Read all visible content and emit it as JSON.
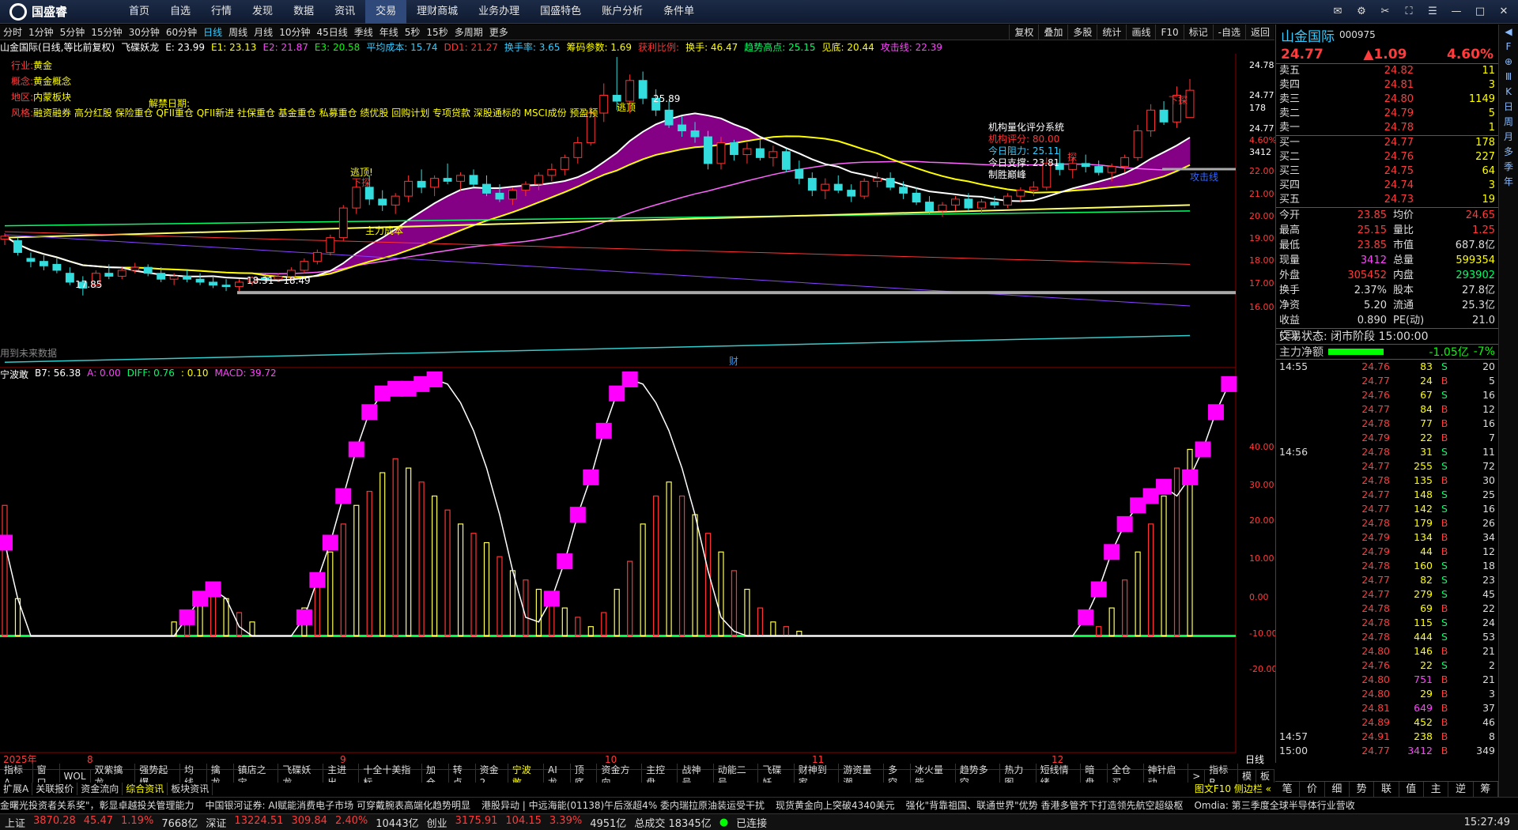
{
  "app": {
    "brand": "国盛睿",
    "menu": [
      "首页",
      "自选",
      "行情",
      "发现",
      "数据",
      "资讯",
      "交易",
      "理财商城",
      "业务办理",
      "国盛特色",
      "账户分析",
      "条件单"
    ],
    "active_menu": "交易"
  },
  "window_controls": [
    "消息",
    "设置",
    "工具",
    "全屏",
    "菜单",
    "最小化",
    "最大化",
    "关闭"
  ],
  "timeframes": [
    "分时",
    "1分钟",
    "5分钟",
    "15分钟",
    "30分钟",
    "60分钟",
    "日线",
    "周线",
    "月线",
    "10分钟",
    "45日线",
    "季线",
    "年线",
    "5秒",
    "15秒",
    "多周期",
    "更多"
  ],
  "active_timeframe": "日线",
  "toolbar_right": [
    "复权",
    "叠加",
    "多股",
    "统计",
    "画线",
    "F10",
    "标记",
    "-自选",
    "返回"
  ],
  "main_header": [
    {
      "t": "山金国际(日线,等比前复权)",
      "c": "#ffffff"
    },
    {
      "t": "飞碟妖龙",
      "c": "#ffffff"
    },
    {
      "t": "E: 23.99",
      "c": "#ffffff"
    },
    {
      "t": "E1: 23.13",
      "c": "#ffff00"
    },
    {
      "t": "E2: 21.87",
      "c": "#ff44ff"
    },
    {
      "t": "E3: 20.58",
      "c": "#00ff00"
    },
    {
      "t": "平均成本: 15.74",
      "c": "#33ccff"
    },
    {
      "t": "DD1: 21.27",
      "c": "#ff3333"
    },
    {
      "t": "换手率: 3.65",
      "c": "#33ccff"
    },
    {
      "t": "筹码参数: 1.69",
      "c": "#ffff00"
    },
    {
      "t": "获利比例:",
      "c": "#ff3333"
    },
    {
      "t": "换手: 46.47",
      "c": "#ffff00"
    },
    {
      "t": "趋势高点: 25.15",
      "c": "#00ff66"
    },
    {
      "t": "见底: 20.44",
      "c": "#ffff00"
    },
    {
      "t": "攻击线: 22.39",
      "c": "#ff44ff"
    }
  ],
  "info_lines": [
    {
      "k": "行业:",
      "v": "黄金"
    },
    {
      "k": "概念:",
      "v": "黄金概念"
    },
    {
      "k": "地区:",
      "v": "内蒙板块"
    },
    {
      "k": "风格:",
      "v": "融资融券 高分红股 保险重仓 QFII重仓 QFII新进 社保重仓 基金重仓 私募重仓 绩优股 回购计划 专项贷款 深股通标的 MSCI成份 预盈预"
    }
  ],
  "unlock_label": "解禁日期:",
  "chart_texts": {
    "lowest": "17.85",
    "range": "18.31 - 18.49",
    "peak": "25.89",
    "escape1": "逃顶!",
    "escape2": "逃顶",
    "sell1": "下探",
    "sell2": "下探",
    "sell3": "下探",
    "main_cost": "主力成本",
    "attack": "攻击线",
    "no_data": "用到未来数据",
    "fin": "财",
    "quant_title": "机构量化评分系统",
    "quant_score": "机构评分: 80.00",
    "resistance": "今日阻力: 25.11",
    "support": "今日支撑: 23.81",
    "win": "制胜巅峰",
    "tan": "探"
  },
  "price_axis": [
    "24.78",
    "24.77",
    "178",
    "24.77",
    "4.60%",
    "3412",
    "22.00",
    "21.00",
    "20.00",
    "19.00",
    "18.00",
    "17.00",
    "16.00"
  ],
  "sub_header": [
    {
      "t": "宁波敢",
      "c": "#ffffff"
    },
    {
      "t": "B7: 56.38",
      "c": "#ffffff"
    },
    {
      "t": "A: 0.00",
      "c": "#ff44ff"
    },
    {
      "t": "DIFF: 0.76",
      "c": "#00ff66"
    },
    {
      "t": ": 0.10",
      "c": "#ffff00"
    },
    {
      "t": "MACD: 39.72",
      "c": "#ff44ff"
    }
  ],
  "sub_axis": [
    "40.00",
    "30.00",
    "20.00",
    "10.00",
    "0.00",
    "-10.00",
    "-20.00"
  ],
  "date_axis": {
    "year": "2025年",
    "months": [
      "8",
      "9",
      "10",
      "11",
      "12"
    ]
  },
  "date_axis_right": "日线",
  "tabs1": [
    "指标A",
    "窗口",
    "WOL",
    "双紫擒龙",
    "强势起爆",
    "均线",
    "擒龙",
    "镇店之宝",
    "飞碟妖龙",
    "主进出",
    "十全十美指标",
    "加仓",
    "转点",
    "资金2",
    "宁波敢",
    "AI龙",
    "顶底",
    "资金方向",
    "主控盘",
    "战神号",
    "动能二号",
    "飞碟妖",
    "财神到家",
    "游资量潮",
    "多空",
    "冰火量能",
    "趋势多空",
    "热力图",
    "短线情绪",
    "暗盘",
    "全仓买",
    "神针启动",
    ">",
    "指标B",
    "模",
    "板"
  ],
  "tabs1_active": "宁波敢",
  "tabs2": [
    "扩展A",
    "关联报价",
    "资金流向",
    "综合资讯",
    "板块资讯"
  ],
  "tabs2_active": "综合资讯",
  "tabs2_right": "图文F10 侧边栏 «",
  "stock": {
    "name": "山金国际",
    "code": "000975",
    "price": "24.77",
    "change": "▲1.09",
    "pct": "4.60%"
  },
  "orderbook": {
    "asks": [
      {
        "l": "卖五",
        "p": "24.82",
        "v": "11"
      },
      {
        "l": "卖四",
        "p": "24.81",
        "v": "3"
      },
      {
        "l": "卖三",
        "p": "24.80",
        "v": "1149"
      },
      {
        "l": "卖二",
        "p": "24.79",
        "v": "5"
      },
      {
        "l": "卖一",
        "p": "24.78",
        "v": "1"
      }
    ],
    "bids": [
      {
        "l": "买一",
        "p": "24.77",
        "v": "178"
      },
      {
        "l": "买二",
        "p": "24.76",
        "v": "227"
      },
      {
        "l": "买三",
        "p": "24.75",
        "v": "64"
      },
      {
        "l": "买四",
        "p": "24.74",
        "v": "3"
      },
      {
        "l": "买五",
        "p": "24.73",
        "v": "19"
      }
    ]
  },
  "stats": [
    {
      "k": "今开",
      "v": "23.85",
      "c": "#ff3b3b",
      "k2": "均价",
      "v2": "24.65",
      "c2": "#ff3b3b"
    },
    {
      "k": "最高",
      "v": "25.15",
      "c": "#ff3b3b",
      "k2": "量比",
      "v2": "1.25",
      "c2": "#ff3b3b"
    },
    {
      "k": "最低",
      "v": "23.85",
      "c": "#ff3b3b",
      "k2": "市值",
      "v2": "687.8亿",
      "c2": "#dddddd"
    },
    {
      "k": "现量",
      "v": "3412",
      "c": "#ff44ff",
      "k2": "总量",
      "v2": "599354",
      "c2": "#ffff00"
    },
    {
      "k": "外盘",
      "v": "305452",
      "c": "#ff3b3b",
      "k2": "内盘",
      "v2": "293902",
      "c2": "#00ff66"
    },
    {
      "k": "换手",
      "v": "2.37%",
      "c": "#dddddd",
      "k2": "股本",
      "v2": "27.8亿",
      "c2": "#dddddd"
    },
    {
      "k": "净资",
      "v": "5.20",
      "c": "#dddddd",
      "k2": "流通",
      "v2": "25.3亿",
      "c2": "#dddddd"
    },
    {
      "k": "收益(三)",
      "v": "0.890",
      "c": "#dddddd",
      "k2": "PE(动)",
      "v2": "21.0",
      "c2": "#dddddd"
    }
  ],
  "trade_status": "交易状态: 闭市阶段 15:00:00",
  "capital_flow": {
    "label": "主力净额",
    "value": "-1.05亿",
    "pct": "-7%"
  },
  "ticks": [
    {
      "t": "14:55",
      "p": "24.76",
      "v": "83",
      "s": "S",
      "n": "20"
    },
    {
      "t": "",
      "p": "24.77",
      "v": "24",
      "s": "B",
      "n": "5"
    },
    {
      "t": "",
      "p": "24.76",
      "v": "67",
      "s": "S",
      "n": "16"
    },
    {
      "t": "",
      "p": "24.77",
      "v": "84",
      "s": "B",
      "n": "12"
    },
    {
      "t": "",
      "p": "24.78",
      "v": "77",
      "s": "B",
      "n": "16"
    },
    {
      "t": "",
      "p": "24.79",
      "v": "22",
      "s": "B",
      "n": "7"
    },
    {
      "t": "14:56",
      "p": "24.78",
      "v": "31",
      "s": "S",
      "n": "11"
    },
    {
      "t": "",
      "p": "24.77",
      "v": "255",
      "s": "S",
      "n": "72"
    },
    {
      "t": "",
      "p": "24.78",
      "v": "135",
      "s": "B",
      "n": "30"
    },
    {
      "t": "",
      "p": "24.77",
      "v": "148",
      "s": "S",
      "n": "25"
    },
    {
      "t": "",
      "p": "24.77",
      "v": "142",
      "s": "S",
      "n": "16"
    },
    {
      "t": "",
      "p": "24.78",
      "v": "179",
      "s": "B",
      "n": "26"
    },
    {
      "t": "",
      "p": "24.79",
      "v": "134",
      "s": "B",
      "n": "34"
    },
    {
      "t": "",
      "p": "24.79",
      "v": "44",
      "s": "B",
      "n": "12"
    },
    {
      "t": "",
      "p": "24.78",
      "v": "160",
      "s": "S",
      "n": "18"
    },
    {
      "t": "",
      "p": "24.77",
      "v": "82",
      "s": "S",
      "n": "23"
    },
    {
      "t": "",
      "p": "24.77",
      "v": "279",
      "s": "S",
      "n": "45"
    },
    {
      "t": "",
      "p": "24.78",
      "v": "69",
      "s": "B",
      "n": "22"
    },
    {
      "t": "",
      "p": "24.78",
      "v": "115",
      "s": "S",
      "n": "24"
    },
    {
      "t": "",
      "p": "24.78",
      "v": "444",
      "s": "S",
      "n": "53"
    },
    {
      "t": "",
      "p": "24.80",
      "v": "146",
      "s": "B",
      "n": "21"
    },
    {
      "t": "",
      "p": "24.76",
      "v": "22",
      "s": "S",
      "n": "2"
    },
    {
      "t": "",
      "p": "24.80",
      "v": "751",
      "s": "B",
      "n": "21"
    },
    {
      "t": "",
      "p": "24.80",
      "v": "29",
      "s": "B",
      "n": "3"
    },
    {
      "t": "",
      "p": "24.81",
      "v": "649",
      "s": "B",
      "n": "37"
    },
    {
      "t": "",
      "p": "24.89",
      "v": "452",
      "s": "B",
      "n": "46"
    },
    {
      "t": "14:57",
      "p": "24.91",
      "v": "238",
      "s": "B",
      "n": "8"
    },
    {
      "t": "15:00",
      "p": "24.77",
      "v": "3412",
      "s": "B",
      "n": "349"
    }
  ],
  "side_tabs": [
    "笔",
    "价",
    "细",
    "势",
    "联",
    "值",
    "主",
    "逆",
    "筹"
  ],
  "right_icons": [
    "◀",
    "F",
    "⊕",
    "Ⅲ",
    "K",
    "日",
    "周",
    "月",
    "多",
    "季",
    "年"
  ],
  "news": [
    "金曙光投资者关系奖\"，彰显卓越投关管理能力",
    "中国银河证券: AI赋能消费电子市场 可穿戴腕表高端化趋势明显",
    "港股异动 | 中远海能(01138)午后涨超4% 委内瑞拉原油装运受干扰",
    "现货黄金向上突破4340美元",
    "强化\"背靠祖国、联通世界\"优势 香港多管齐下打造领先航空超级枢",
    "Omdia: 第三季度全球半导体行业营收"
  ],
  "index_bar": [
    {
      "name": "上证",
      "val": "3870.28",
      "chg": "45.47",
      "pct": "1.19%",
      "amt": "7668亿"
    },
    {
      "name": "深证",
      "val": "13224.51",
      "chg": "309.84",
      "pct": "2.40%",
      "amt": "10443亿"
    },
    {
      "name": "创业",
      "val": "3175.91",
      "chg": "104.15",
      "pct": "3.39%",
      "amt": "4951亿"
    }
  ],
  "total_amt": "总成交 18345亿",
  "connected": "已连接",
  "clock": "15:27:49",
  "chart_data": {
    "type": "candlestick",
    "price_range": [
      15.5,
      26.0
    ],
    "candles": [
      [
        19.75,
        19.95,
        19.55,
        19.85
      ],
      [
        19.7,
        19.8,
        19.2,
        19.3
      ],
      [
        19.1,
        19.3,
        18.8,
        19.0
      ],
      [
        19.0,
        19.2,
        18.7,
        18.85
      ],
      [
        18.9,
        19.1,
        18.6,
        18.7
      ],
      [
        18.6,
        18.8,
        18.2,
        18.3
      ],
      [
        18.3,
        18.5,
        17.85,
        18.1
      ],
      [
        18.2,
        18.7,
        18.1,
        18.6
      ],
      [
        18.6,
        18.9,
        18.4,
        18.5
      ],
      [
        18.5,
        18.8,
        18.4,
        18.7
      ],
      [
        18.7,
        18.95,
        18.6,
        18.8
      ],
      [
        18.8,
        18.9,
        18.5,
        18.6
      ],
      [
        18.6,
        18.8,
        18.3,
        18.4
      ],
      [
        18.4,
        18.6,
        18.2,
        18.5
      ],
      [
        18.5,
        18.7,
        18.3,
        18.4
      ],
      [
        18.4,
        18.6,
        18.2,
        18.3
      ],
      [
        18.3,
        18.5,
        18.1,
        18.2
      ],
      [
        18.2,
        18.4,
        18.0,
        18.15
      ],
      [
        18.15,
        18.4,
        18.0,
        18.3
      ],
      [
        18.3,
        18.5,
        18.2,
        18.45
      ],
      [
        18.45,
        18.6,
        18.3,
        18.4
      ],
      [
        18.4,
        18.6,
        18.31,
        18.49
      ],
      [
        18.49,
        18.8,
        18.4,
        18.7
      ],
      [
        18.7,
        19.1,
        18.6,
        19.0
      ],
      [
        19.0,
        19.4,
        18.9,
        19.3
      ],
      [
        19.3,
        19.9,
        19.2,
        19.8
      ],
      [
        19.8,
        20.9,
        19.7,
        20.8
      ],
      [
        20.8,
        21.7,
        20.6,
        21.5
      ],
      [
        21.5,
        21.9,
        20.9,
        21.1
      ],
      [
        21.1,
        21.4,
        20.7,
        20.9
      ],
      [
        20.9,
        21.3,
        20.6,
        21.2
      ],
      [
        21.2,
        21.9,
        21.0,
        21.7
      ],
      [
        21.7,
        22.1,
        21.3,
        21.5
      ],
      [
        21.5,
        21.9,
        21.2,
        21.8
      ],
      [
        21.8,
        22.3,
        21.6,
        21.7
      ],
      [
        21.7,
        22.0,
        21.4,
        21.9
      ],
      [
        21.9,
        22.1,
        21.5,
        21.6
      ],
      [
        21.6,
        21.9,
        21.2,
        21.3
      ],
      [
        21.3,
        21.6,
        21.0,
        21.1
      ],
      [
        21.1,
        21.5,
        20.9,
        21.4
      ],
      [
        21.4,
        21.7,
        21.2,
        21.6
      ],
      [
        21.6,
        22.0,
        21.4,
        21.9
      ],
      [
        21.9,
        22.3,
        21.7,
        22.1
      ],
      [
        22.1,
        22.6,
        21.9,
        22.5
      ],
      [
        22.5,
        23.2,
        22.3,
        23.0
      ],
      [
        23.0,
        24.2,
        22.9,
        24.0
      ],
      [
        24.0,
        25.0,
        23.7,
        24.6
      ],
      [
        24.6,
        25.89,
        24.1,
        24.4
      ],
      [
        24.4,
        25.3,
        24.0,
        25.1
      ],
      [
        25.1,
        25.4,
        24.3,
        24.5
      ],
      [
        24.5,
        24.8,
        23.9,
        24.1
      ],
      [
        24.1,
        24.4,
        23.5,
        23.6
      ],
      [
        23.6,
        23.9,
        23.2,
        23.4
      ],
      [
        23.4,
        23.7,
        23.0,
        23.2
      ],
      [
        23.2,
        23.4,
        22.1,
        22.3
      ],
      [
        22.3,
        23.2,
        22.1,
        23.0
      ],
      [
        23.0,
        23.1,
        22.4,
        22.6
      ],
      [
        22.6,
        23.0,
        22.3,
        22.8
      ],
      [
        22.8,
        23.1,
        22.4,
        22.5
      ],
      [
        22.5,
        22.9,
        22.2,
        22.7
      ],
      [
        22.7,
        22.8,
        22.0,
        22.1
      ],
      [
        22.1,
        22.4,
        21.6,
        21.8
      ],
      [
        21.8,
        22.0,
        21.2,
        21.4
      ],
      [
        21.4,
        21.8,
        21.1,
        21.6
      ],
      [
        21.6,
        21.9,
        21.3,
        21.4
      ],
      [
        21.4,
        21.6,
        21.0,
        21.2
      ],
      [
        21.2,
        21.8,
        21.1,
        21.7
      ],
      [
        21.7,
        22.0,
        21.5,
        21.8
      ],
      [
        21.8,
        22.0,
        21.4,
        21.5
      ],
      [
        21.5,
        21.7,
        21.1,
        21.3
      ],
      [
        21.3,
        21.5,
        20.9,
        21.0
      ],
      [
        21.0,
        21.2,
        20.6,
        20.7
      ],
      [
        20.7,
        21.0,
        20.5,
        20.9
      ],
      [
        20.9,
        21.2,
        20.7,
        21.1
      ],
      [
        21.1,
        21.3,
        20.7,
        20.8
      ],
      [
        20.8,
        21.1,
        20.6,
        21.0
      ],
      [
        21.0,
        21.2,
        20.8,
        20.9
      ],
      [
        20.9,
        21.3,
        20.8,
        21.2
      ],
      [
        21.2,
        21.5,
        21.0,
        21.4
      ],
      [
        21.4,
        21.7,
        21.2,
        21.5
      ],
      [
        21.5,
        22.5,
        21.4,
        22.3
      ],
      [
        22.3,
        22.8,
        21.9,
        22.1
      ],
      [
        22.1,
        22.5,
        21.8,
        22.3
      ],
      [
        22.3,
        22.6,
        22.0,
        22.2
      ],
      [
        22.2,
        22.4,
        21.9,
        22.0
      ],
      [
        22.0,
        22.3,
        21.7,
        22.2
      ],
      [
        22.2,
        22.6,
        22.0,
        22.5
      ],
      [
        22.5,
        23.6,
        22.4,
        23.4
      ],
      [
        23.4,
        24.3,
        23.2,
        24.1
      ],
      [
        24.1,
        24.4,
        23.6,
        23.7
      ],
      [
        23.7,
        24.9,
        23.5,
        24.6
      ],
      [
        23.85,
        25.15,
        23.85,
        24.77
      ]
    ]
  },
  "sub_chart_data": {
    "type": "macd",
    "ylim": [
      -25,
      55
    ],
    "hist": [
      28,
      8,
      0,
      0,
      0,
      0,
      0,
      0,
      0,
      0,
      0,
      0,
      0,
      3,
      5,
      8,
      10,
      8,
      5,
      3,
      0,
      0,
      0,
      6,
      12,
      18,
      24,
      28,
      31,
      35,
      38,
      36,
      33,
      30,
      27,
      24,
      22,
      20,
      17,
      14,
      12,
      10,
      8,
      6,
      4,
      2,
      5,
      10,
      16,
      24,
      30,
      33,
      30,
      26,
      22,
      18,
      14,
      10,
      6,
      3,
      2,
      1,
      0,
      0,
      0,
      0,
      0,
      0,
      0,
      0,
      0,
      0,
      0,
      0,
      0,
      0,
      0,
      0,
      0,
      0,
      0,
      0,
      0,
      0,
      2,
      6,
      12,
      18,
      24,
      30,
      36,
      40
    ],
    "line": [
      20,
      8,
      0,
      0,
      0,
      0,
      0,
      0,
      0,
      0,
      0,
      0,
      0,
      0,
      4,
      8,
      10,
      8,
      2,
      0,
      0,
      0,
      0,
      4,
      12,
      20,
      30,
      40,
      48,
      52,
      53,
      53,
      54,
      55,
      54,
      50,
      44,
      36,
      26,
      14,
      4,
      3,
      8,
      16,
      26,
      34,
      44,
      52,
      55,
      54,
      50,
      44,
      36,
      26,
      14,
      4,
      1,
      0,
      0,
      0,
      0,
      0,
      0,
      0,
      0,
      0,
      0,
      0,
      0,
      0,
      0,
      0,
      0,
      0,
      0,
      0,
      0,
      0,
      0,
      0,
      0,
      0,
      0,
      4,
      10,
      18,
      24,
      28,
      30,
      32,
      30,
      34,
      40,
      48,
      54
    ]
  }
}
